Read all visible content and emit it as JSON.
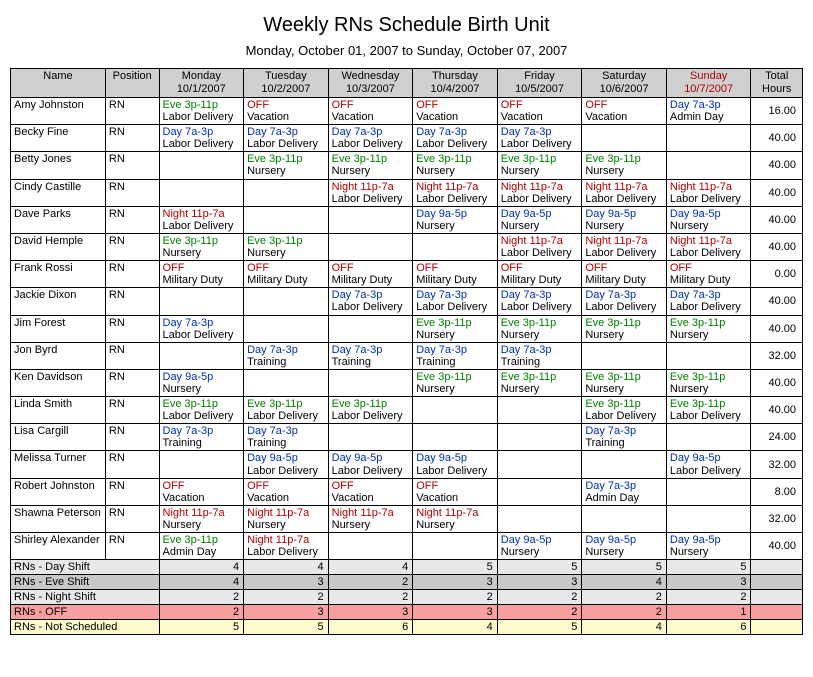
{
  "title": "Weekly RNs Schedule Birth Unit",
  "subtitle": "Monday, October 01, 2007 to Sunday, October 07, 2007",
  "headers": {
    "name": "Name",
    "position": "Position",
    "days": [
      {
        "top": "Monday",
        "bottom": "10/1/2007"
      },
      {
        "top": "Tuesday",
        "bottom": "10/2/2007"
      },
      {
        "top": "Wednesday",
        "bottom": "10/3/2007"
      },
      {
        "top": "Thursday",
        "bottom": "10/4/2007"
      },
      {
        "top": "Friday",
        "bottom": "10/5/2007"
      },
      {
        "top": "Saturday",
        "bottom": "10/6/2007"
      },
      {
        "top": "Sunday",
        "bottom": "10/7/2007"
      }
    ],
    "total": "Total Hours"
  },
  "rows": [
    {
      "name": "Amy Johnston",
      "pos": "RN",
      "total": "16.00",
      "cells": [
        {
          "shift": "Eve 3p-11p",
          "color": "green",
          "task": "Labor Delivery"
        },
        {
          "shift": "OFF",
          "color": "red",
          "task": "Vacation"
        },
        {
          "shift": "OFF",
          "color": "red",
          "task": "Vacation"
        },
        {
          "shift": "OFF",
          "color": "red",
          "task": "Vacation"
        },
        {
          "shift": "OFF",
          "color": "red",
          "task": "Vacation"
        },
        {
          "shift": "OFF",
          "color": "red",
          "task": "Vacation"
        },
        {
          "shift": "Day 7a-3p",
          "color": "blue",
          "task": "Admin Day"
        }
      ]
    },
    {
      "name": "Becky Fine",
      "pos": "RN",
      "total": "40.00",
      "cells": [
        {
          "shift": "Day 7a-3p",
          "color": "blue",
          "task": "Labor Delivery"
        },
        {
          "shift": "Day 7a-3p",
          "color": "blue",
          "task": "Labor Delivery"
        },
        {
          "shift": "Day 7a-3p",
          "color": "blue",
          "task": "Labor Delivery"
        },
        {
          "shift": "Day 7a-3p",
          "color": "blue",
          "task": "Labor Delivery"
        },
        {
          "shift": "Day 7a-3p",
          "color": "blue",
          "task": "Labor Delivery"
        },
        null,
        null
      ]
    },
    {
      "name": "Betty Jones",
      "pos": "RN",
      "total": "40.00",
      "cells": [
        null,
        {
          "shift": "Eve 3p-11p",
          "color": "green",
          "task": "Nursery"
        },
        {
          "shift": "Eve 3p-11p",
          "color": "green",
          "task": "Nursery"
        },
        {
          "shift": "Eve 3p-11p",
          "color": "green",
          "task": "Nursery"
        },
        {
          "shift": "Eve 3p-11p",
          "color": "green",
          "task": "Nursery"
        },
        {
          "shift": "Eve 3p-11p",
          "color": "green",
          "task": "Nursery"
        },
        null
      ]
    },
    {
      "name": "Cindy Castille",
      "pos": "RN",
      "total": "40.00",
      "cells": [
        null,
        null,
        {
          "shift": "Night 11p-7a",
          "color": "red",
          "task": "Labor Delivery"
        },
        {
          "shift": "Night 11p-7a",
          "color": "red",
          "task": "Labor Delivery"
        },
        {
          "shift": "Night 11p-7a",
          "color": "red",
          "task": "Labor Delivery"
        },
        {
          "shift": "Night 11p-7a",
          "color": "red",
          "task": "Labor Delivery"
        },
        {
          "shift": "Night 11p-7a",
          "color": "red",
          "task": "Labor Delivery"
        }
      ]
    },
    {
      "name": "Dave Parks",
      "pos": "RN",
      "total": "40.00",
      "cells": [
        {
          "shift": "Night 11p-7a",
          "color": "red",
          "task": "Labor Delivery"
        },
        null,
        null,
        {
          "shift": "Day 9a-5p",
          "color": "blue",
          "task": "Nursery"
        },
        {
          "shift": "Day 9a-5p",
          "color": "blue",
          "task": "Nursery"
        },
        {
          "shift": "Day 9a-5p",
          "color": "blue",
          "task": "Nursery"
        },
        {
          "shift": "Day 9a-5p",
          "color": "blue",
          "task": "Nursery"
        }
      ]
    },
    {
      "name": "David Hemple",
      "pos": "RN",
      "total": "40.00",
      "cells": [
        {
          "shift": "Eve 3p-11p",
          "color": "green",
          "task": "Nursery"
        },
        {
          "shift": "Eve 3p-11p",
          "color": "green",
          "task": "Nursery"
        },
        null,
        null,
        {
          "shift": "Night 11p-7a",
          "color": "red",
          "task": "Labor Delivery"
        },
        {
          "shift": "Night 11p-7a",
          "color": "red",
          "task": "Labor Delivery"
        },
        {
          "shift": "Night 11p-7a",
          "color": "red",
          "task": "Labor Delivery"
        }
      ]
    },
    {
      "name": "Frank Rossi",
      "pos": "RN",
      "total": "0.00",
      "cells": [
        {
          "shift": "OFF",
          "color": "red",
          "task": "Military Duty"
        },
        {
          "shift": "OFF",
          "color": "red",
          "task": "Military Duty"
        },
        {
          "shift": "OFF",
          "color": "red",
          "task": "Military Duty"
        },
        {
          "shift": "OFF",
          "color": "red",
          "task": "Military Duty"
        },
        {
          "shift": "OFF",
          "color": "red",
          "task": "Military Duty"
        },
        {
          "shift": "OFF",
          "color": "red",
          "task": "Military Duty"
        },
        {
          "shift": "OFF",
          "color": "red",
          "task": "Military Duty"
        }
      ]
    },
    {
      "name": "Jackie Dixon",
      "pos": "RN",
      "total": "40.00",
      "cells": [
        null,
        null,
        {
          "shift": "Day 7a-3p",
          "color": "blue",
          "task": "Labor Delivery"
        },
        {
          "shift": "Day 7a-3p",
          "color": "blue",
          "task": "Labor Delivery"
        },
        {
          "shift": "Day 7a-3p",
          "color": "blue",
          "task": "Labor Delivery"
        },
        {
          "shift": "Day 7a-3p",
          "color": "blue",
          "task": "Labor Delivery"
        },
        {
          "shift": "Day 7a-3p",
          "color": "blue",
          "task": "Labor Delivery"
        }
      ]
    },
    {
      "name": "Jim Forest",
      "pos": "RN",
      "total": "40.00",
      "cells": [
        {
          "shift": "Day 7a-3p",
          "color": "blue",
          "task": "Labor Delivery"
        },
        null,
        null,
        {
          "shift": "Eve 3p-11p",
          "color": "green",
          "task": "Nursery"
        },
        {
          "shift": "Eve 3p-11p",
          "color": "green",
          "task": "Nursery"
        },
        {
          "shift": "Eve 3p-11p",
          "color": "green",
          "task": "Nursery"
        },
        {
          "shift": "Eve 3p-11p",
          "color": "green",
          "task": "Nursery"
        }
      ]
    },
    {
      "name": "Jon Byrd",
      "pos": "RN",
      "total": "32.00",
      "cells": [
        null,
        {
          "shift": "Day 7a-3p",
          "color": "blue",
          "task": "Training"
        },
        {
          "shift": "Day 7a-3p",
          "color": "blue",
          "task": "Training"
        },
        {
          "shift": "Day 7a-3p",
          "color": "blue",
          "task": "Training"
        },
        {
          "shift": "Day 7a-3p",
          "color": "blue",
          "task": "Training"
        },
        null,
        null
      ]
    },
    {
      "name": "Ken Davidson",
      "pos": "RN",
      "total": "40.00",
      "cells": [
        {
          "shift": "Day 9a-5p",
          "color": "blue",
          "task": "Nursery"
        },
        null,
        null,
        {
          "shift": "Eve 3p-11p",
          "color": "green",
          "task": "Nursery"
        },
        {
          "shift": "Eve 3p-11p",
          "color": "green",
          "task": "Nursery"
        },
        {
          "shift": "Eve 3p-11p",
          "color": "green",
          "task": "Nursery"
        },
        {
          "shift": "Eve 3p-11p",
          "color": "green",
          "task": "Nursery"
        }
      ]
    },
    {
      "name": "Linda Smith",
      "pos": "RN",
      "total": "40.00",
      "cells": [
        {
          "shift": "Eve 3p-11p",
          "color": "green",
          "task": "Labor Delivery"
        },
        {
          "shift": "Eve 3p-11p",
          "color": "green",
          "task": "Labor Delivery"
        },
        {
          "shift": "Eve 3p-11p",
          "color": "green",
          "task": "Labor Delivery"
        },
        null,
        null,
        {
          "shift": "Eve 3p-11p",
          "color": "green",
          "task": "Labor Delivery"
        },
        {
          "shift": "Eve 3p-11p",
          "color": "green",
          "task": "Labor Delivery"
        }
      ]
    },
    {
      "name": "Lisa Cargill",
      "pos": "RN",
      "total": "24.00",
      "cells": [
        {
          "shift": "Day 7a-3p",
          "color": "blue",
          "task": "Training"
        },
        {
          "shift": "Day 7a-3p",
          "color": "blue",
          "task": "Training"
        },
        null,
        null,
        null,
        {
          "shift": "Day 7a-3p",
          "color": "blue",
          "task": "Training"
        },
        null
      ]
    },
    {
      "name": "Melissa Turner",
      "pos": "RN",
      "total": "32.00",
      "cells": [
        null,
        {
          "shift": "Day 9a-5p",
          "color": "blue",
          "task": "Labor Delivery"
        },
        {
          "shift": "Day 9a-5p",
          "color": "blue",
          "task": "Labor Delivery"
        },
        {
          "shift": "Day 9a-5p",
          "color": "blue",
          "task": "Labor Delivery"
        },
        null,
        null,
        {
          "shift": "Day 9a-5p",
          "color": "blue",
          "task": "Labor Delivery"
        }
      ]
    },
    {
      "name": "Robert Johnston",
      "pos": "RN",
      "total": "8.00",
      "cells": [
        {
          "shift": "OFF",
          "color": "red",
          "task": "Vacation"
        },
        {
          "shift": "OFF",
          "color": "red",
          "task": "Vacation"
        },
        {
          "shift": "OFF",
          "color": "red",
          "task": "Vacation"
        },
        {
          "shift": "OFF",
          "color": "red",
          "task": "Vacation"
        },
        null,
        {
          "shift": "Day 7a-3p",
          "color": "blue",
          "task": "Admin Day"
        },
        null
      ]
    },
    {
      "name": "Shawna Peterson",
      "pos": "RN",
      "total": "32.00",
      "cells": [
        {
          "shift": "Night 11p-7a",
          "color": "red",
          "task": "Nursery"
        },
        {
          "shift": "Night 11p-7a",
          "color": "red",
          "task": "Nursery"
        },
        {
          "shift": "Night 11p-7a",
          "color": "red",
          "task": "Nursery"
        },
        {
          "shift": "Night 11p-7a",
          "color": "red",
          "task": "Nursery"
        },
        null,
        null,
        null
      ]
    },
    {
      "name": "Shirley Alexander",
      "pos": "RN",
      "total": "40.00",
      "cells": [
        {
          "shift": "Eve 3p-11p",
          "color": "green",
          "task": "Admin Day"
        },
        {
          "shift": "Night 11p-7a",
          "color": "red",
          "task": "Labor Delivery"
        },
        null,
        null,
        {
          "shift": "Day 9a-5p",
          "color": "blue",
          "task": "Nursery"
        },
        {
          "shift": "Day 9a-5p",
          "color": "blue",
          "task": "Nursery"
        },
        {
          "shift": "Day 9a-5p",
          "color": "blue",
          "task": "Nursery"
        }
      ]
    }
  ],
  "summary": [
    {
      "label": "RNs - Day Shift",
      "bg": "grey1",
      "vals": [
        "4",
        "4",
        "4",
        "5",
        "5",
        "5",
        "5"
      ]
    },
    {
      "label": "RNs - Eve Shift",
      "bg": "grey2",
      "vals": [
        "4",
        "3",
        "2",
        "3",
        "3",
        "4",
        "3"
      ]
    },
    {
      "label": "RNs - Night Shift",
      "bg": "grey3",
      "vals": [
        "2",
        "2",
        "2",
        "2",
        "2",
        "2",
        "2"
      ]
    },
    {
      "label": "RNs - OFF",
      "bg": "pink",
      "vals": [
        "2",
        "3",
        "3",
        "3",
        "2",
        "2",
        "1"
      ]
    },
    {
      "label": "RNs - Not Scheduled",
      "bg": "yellow",
      "vals": [
        "5",
        "5",
        "6",
        "4",
        "5",
        "4",
        "6"
      ]
    }
  ]
}
